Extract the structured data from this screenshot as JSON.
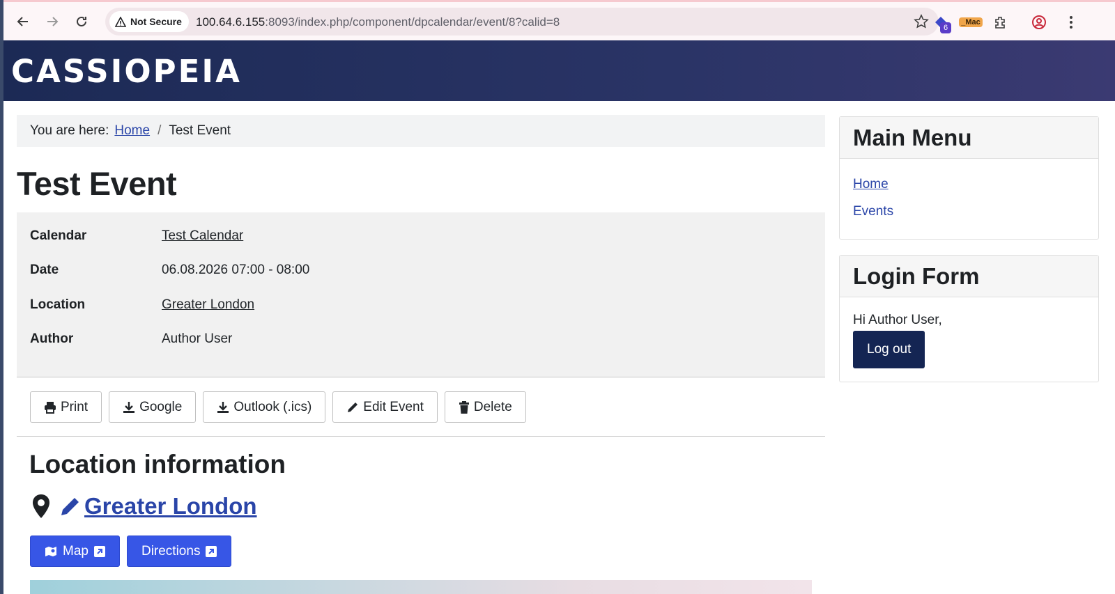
{
  "browser": {
    "security_label": "Not Secure",
    "url_host": "100.64.6.155",
    "url_path": ":8093/index.php/component/dpcalendar/event/8?calid=8",
    "extension_badge": "6",
    "extension_label": "_Mac"
  },
  "site": {
    "brand": "CASSIOPEIA"
  },
  "breadcrumb": {
    "prefix": "You are here:",
    "home": "Home",
    "separator": "/",
    "current": "Test Event"
  },
  "event": {
    "title": "Test Event",
    "details": [
      {
        "label": "Calendar",
        "value": "Test Calendar",
        "link": true
      },
      {
        "label": "Date",
        "value": "06.08.2026 07:00 - 08:00",
        "link": false
      },
      {
        "label": "Location",
        "value": "Greater London",
        "link": true
      },
      {
        "label": "Author",
        "value": "Author User",
        "link": false
      }
    ],
    "actions": {
      "print": "Print",
      "google": "Google",
      "outlook": "Outlook (.ics)",
      "edit": "Edit Event",
      "delete": "Delete"
    }
  },
  "location": {
    "heading": "Location information",
    "name": "Greater London",
    "map_button": "Map",
    "directions_button": "Directions"
  },
  "sidebar": {
    "main_menu": {
      "title": "Main Menu",
      "items": [
        "Home",
        "Events"
      ]
    },
    "login": {
      "title": "Login Form",
      "greeting": "Hi Author User,",
      "logout": "Log out"
    }
  },
  "colors": {
    "banner": "#1c2a55",
    "link": "#2a45a8",
    "primary_button": "#3756e6",
    "logout_button": "#142553"
  }
}
